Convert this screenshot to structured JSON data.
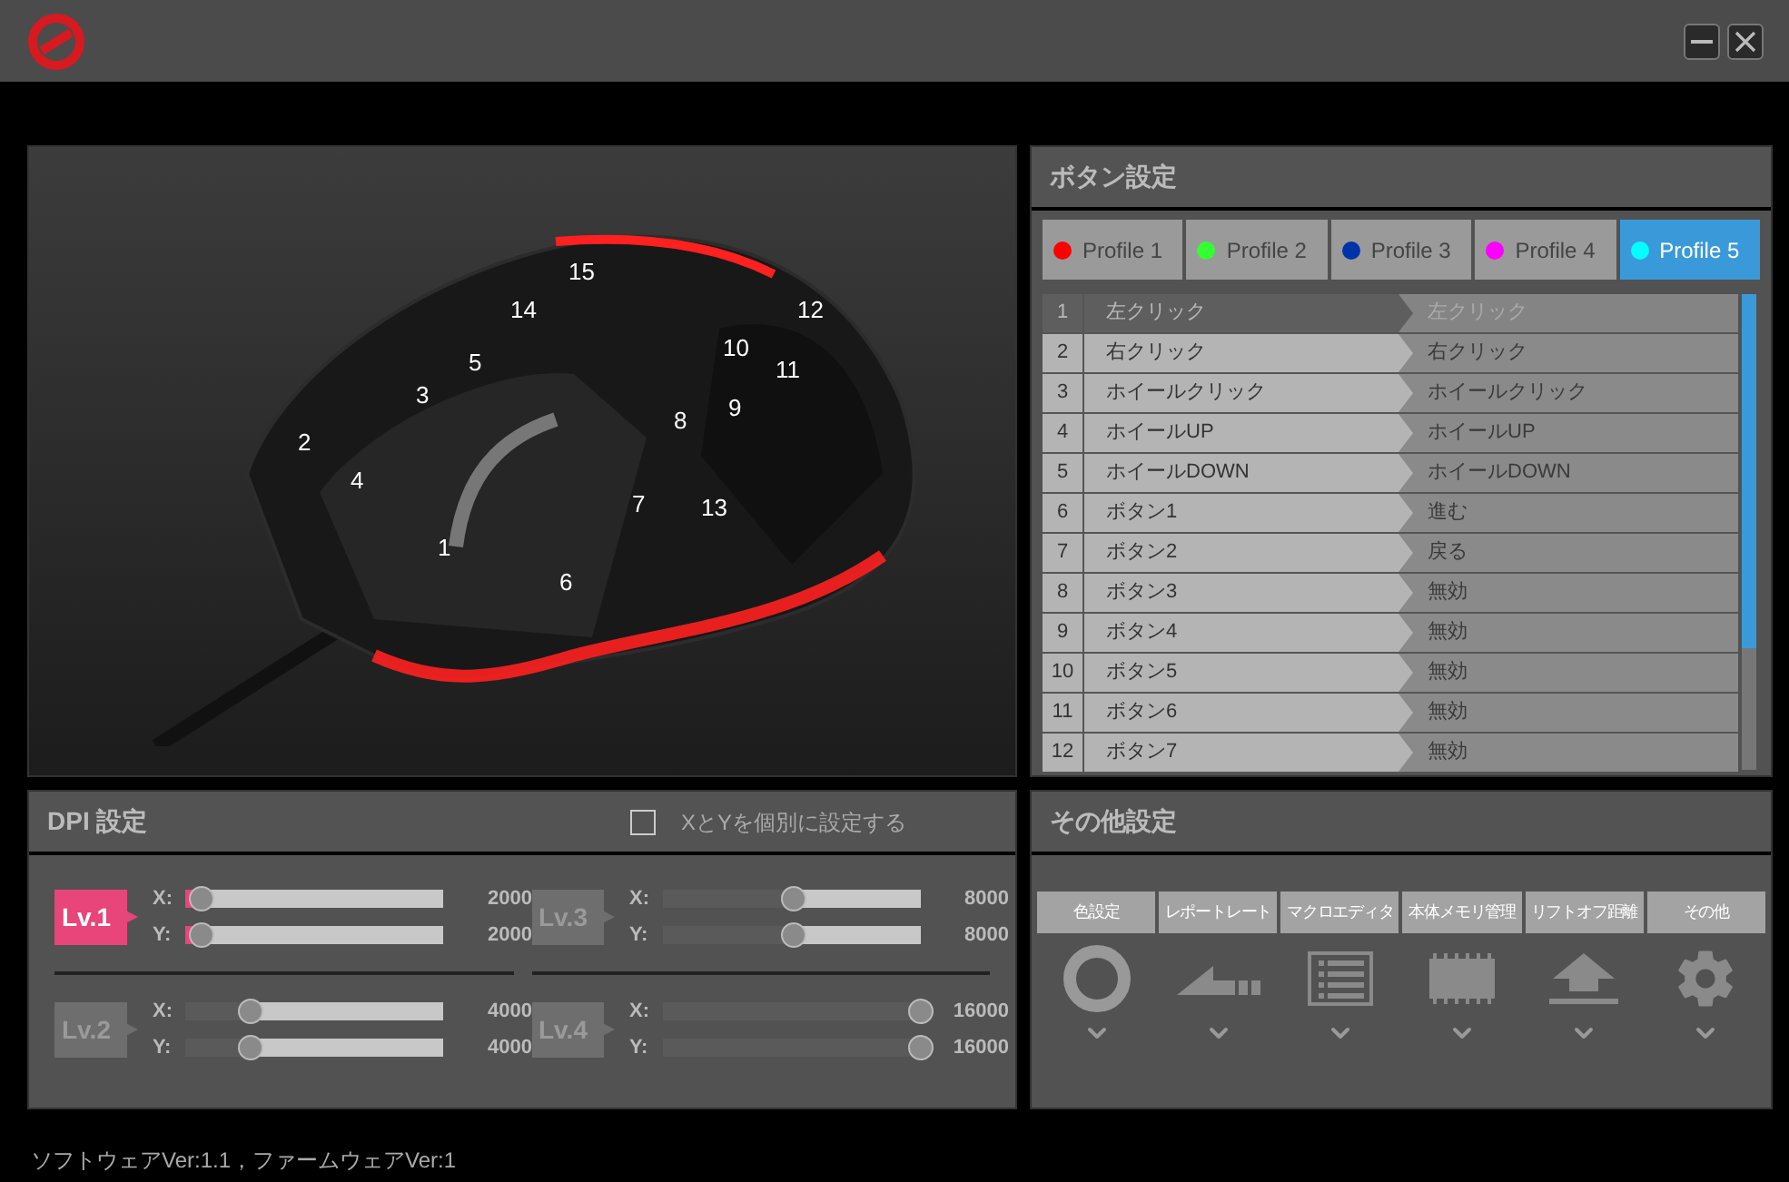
{
  "mouse_view": {
    "callouts": [
      "1",
      "2",
      "3",
      "4",
      "5",
      "6",
      "7",
      "8",
      "9",
      "10",
      "11",
      "12",
      "13",
      "14",
      "15"
    ]
  },
  "button_settings": {
    "title": "ボタン設定",
    "profiles": [
      {
        "label": "Profile 1",
        "color": "#ff0000",
        "selected": false
      },
      {
        "label": "Profile 2",
        "color": "#33ff33",
        "selected": false
      },
      {
        "label": "Profile 3",
        "color": "#0033aa",
        "selected": false
      },
      {
        "label": "Profile 4",
        "color": "#ff00ff",
        "selected": false
      },
      {
        "label": "Profile 5",
        "color": "#00ffff",
        "selected": true
      }
    ],
    "rows": [
      {
        "number": "1",
        "button": "左クリック",
        "assignment": "左クリック",
        "selected": true
      },
      {
        "number": "2",
        "button": "右クリック",
        "assignment": "右クリック",
        "selected": false
      },
      {
        "number": "3",
        "button": "ホイールクリック",
        "assignment": "ホイールクリック",
        "selected": false
      },
      {
        "number": "4",
        "button": "ホイールUP",
        "assignment": "ホイールUP",
        "selected": false
      },
      {
        "number": "5",
        "button": "ホイールDOWN",
        "assignment": "ホイールDOWN",
        "selected": false
      },
      {
        "number": "6",
        "button": "ボタン1",
        "assignment": "進む",
        "selected": false
      },
      {
        "number": "7",
        "button": "ボタン2",
        "assignment": "戻る",
        "selected": false
      },
      {
        "number": "8",
        "button": "ボタン3",
        "assignment": "無効",
        "selected": false
      },
      {
        "number": "9",
        "button": "ボタン4",
        "assignment": "無効",
        "selected": false
      },
      {
        "number": "10",
        "button": "ボタン5",
        "assignment": "無効",
        "selected": false
      },
      {
        "number": "11",
        "button": "ボタン6",
        "assignment": "無効",
        "selected": false
      },
      {
        "number": "12",
        "button": "ボタン7",
        "assignment": "無効",
        "selected": false
      }
    ]
  },
  "dpi_settings": {
    "title": "DPI 設定",
    "separate_xy": {
      "label": "XとYを個別に設定する",
      "checked": false
    },
    "levels": [
      {
        "label": "Lv.1",
        "selected": true,
        "axes": [
          {
            "axis": "X:",
            "level": 0.06,
            "value": "2000"
          },
          {
            "axis": "Y:",
            "level": 0.06,
            "value": "2000"
          }
        ]
      },
      {
        "label": "Lv.3",
        "selected": false,
        "axes": [
          {
            "axis": "X:",
            "level": 0.51,
            "value": "8000"
          },
          {
            "axis": "Y:",
            "level": 0.51,
            "value": "8000"
          }
        ]
      },
      {
        "label": "Lv.2",
        "selected": false,
        "axes": [
          {
            "axis": "X:",
            "level": 0.25,
            "value": "4000"
          },
          {
            "axis": "Y:",
            "level": 0.25,
            "value": "4000"
          }
        ]
      },
      {
        "label": "Lv.4",
        "selected": false,
        "axes": [
          {
            "axis": "X:",
            "level": 1,
            "value": "16000"
          },
          {
            "axis": "Y:",
            "level": 1,
            "value": "16000"
          }
        ]
      }
    ]
  },
  "other_settings": {
    "title": "その他設定",
    "items": [
      {
        "label": "色設定",
        "kind": "color"
      },
      {
        "label": "レポートレート",
        "kind": "rate"
      },
      {
        "label": "マクロエディタ",
        "kind": "macro"
      },
      {
        "label": "本体メモリ管理",
        "kind": "memory"
      },
      {
        "label": "リフトオフ距離",
        "kind": "liftoff"
      },
      {
        "label": "その他",
        "kind": "other"
      }
    ]
  },
  "footer": "ソフトウェアVer:1.1，ファームウェアVer:1"
}
